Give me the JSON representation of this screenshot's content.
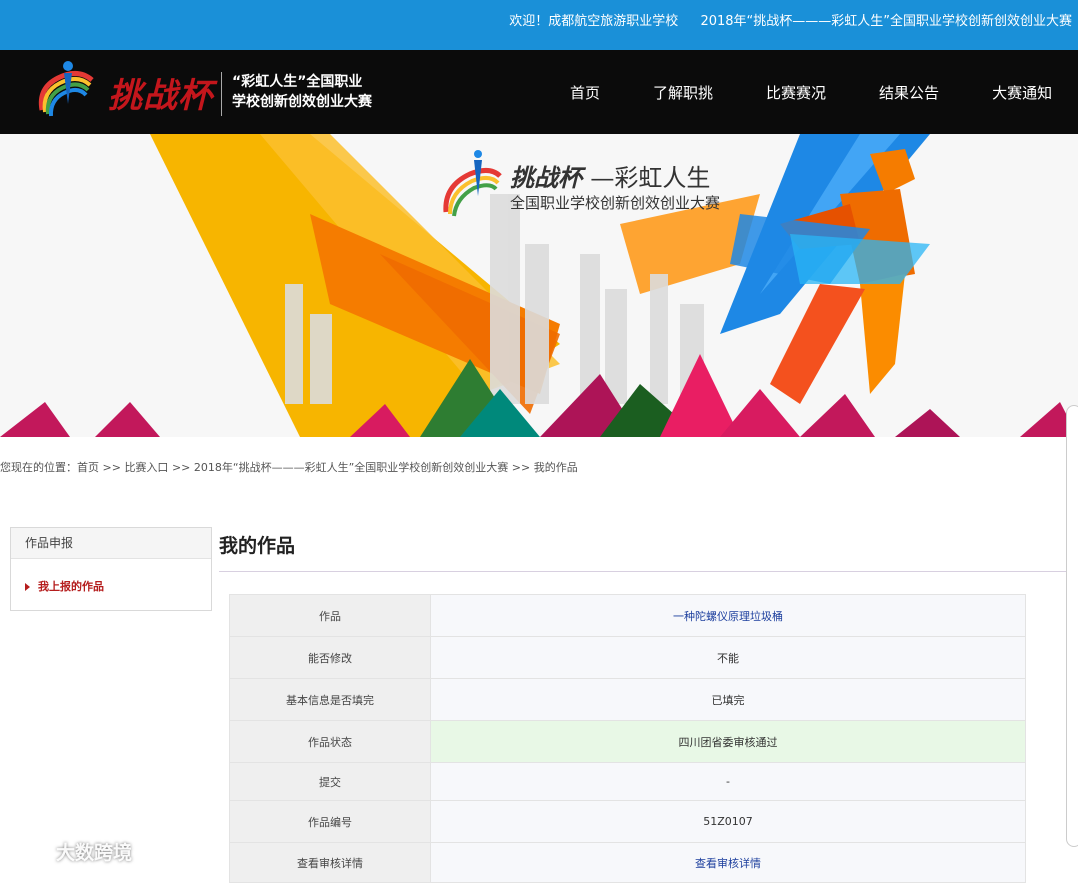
{
  "topbar": {
    "welcome": "欢迎！成都航空旅游职业学校",
    "event": "2018年“挑战杯———彩虹人生”全国职业学校创新创效创业大赛"
  },
  "header": {
    "logo_title": "挑战杯",
    "logo_sub_line1": "“彩虹人生”全国职业",
    "logo_sub_line2": "学校创新创效创业大赛",
    "nav": [
      {
        "label": "首页"
      },
      {
        "label": "了解职挑"
      },
      {
        "label": "比赛赛况"
      },
      {
        "label": "结果公告"
      },
      {
        "label": "大赛通知"
      }
    ]
  },
  "banner": {
    "title_main": "挑战杯",
    "title_dash": "—彩虹人生",
    "subtitle": "全国职业学校创新创效创业大赛"
  },
  "breadcrumb": {
    "prefix": "您现在的位置：",
    "items": [
      "首页",
      "比赛入口",
      "2018年“挑战杯———彩虹人生”全国职业学校创新创效创业大赛",
      "我的作品"
    ],
    "separator": ">>"
  },
  "sidebar": {
    "header": "作品申报",
    "item": "我上报的作品"
  },
  "main": {
    "title": "我的作品",
    "rows": [
      {
        "key": "作品",
        "value": "一种陀螺仪原理垃圾桶"
      },
      {
        "key": "能否修改",
        "value": "不能"
      },
      {
        "key": "基本信息是否填完",
        "value": "已填完"
      },
      {
        "key": "作品状态",
        "value": "四川团省委审核通过"
      },
      {
        "key": "提交",
        "value": "-"
      },
      {
        "key": "作品编号",
        "value": "51Z0107"
      },
      {
        "key": "查看审核详情",
        "value": "查看审核详情"
      }
    ]
  },
  "watermark": "大数跨境",
  "colors": {
    "topbar": "#1a90d8",
    "header": "#0b0b0b",
    "accent_red": "#b51d1d",
    "link_blue": "#1d3f9e",
    "status_green": "#e8f8e6"
  }
}
